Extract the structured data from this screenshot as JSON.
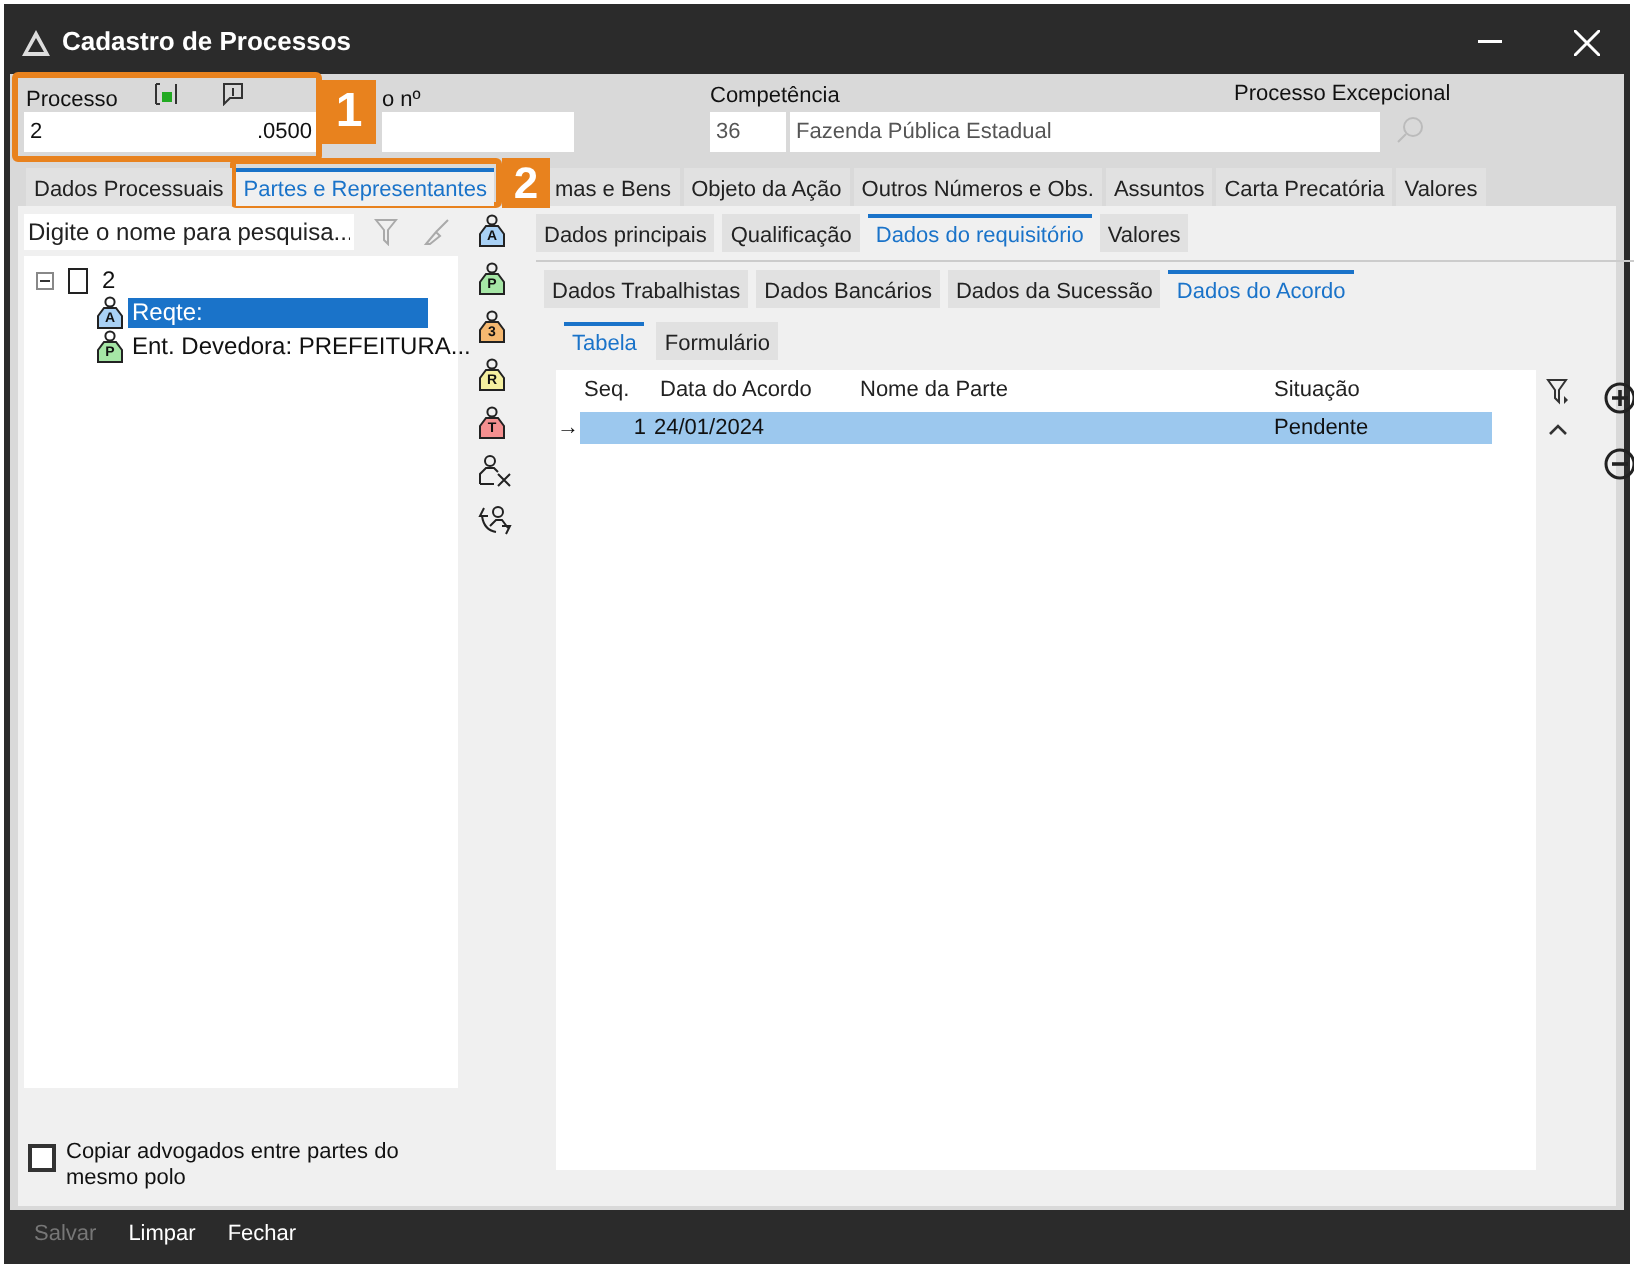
{
  "window": {
    "title": "Cadastro de Processos"
  },
  "header": {
    "process_label": "Processo",
    "process_value_start": "2",
    "process_value_end": ".0500",
    "second_label": "o nº",
    "competencia_label": "Competência",
    "competencia_code": "36",
    "competencia_name": "Fazenda Pública Estadual",
    "excepcional_label": "Processo Excepcional"
  },
  "tabs": [
    {
      "label": "Dados Processuais",
      "selected": false
    },
    {
      "label": "Partes e Representantes",
      "selected": true
    },
    {
      "label": "mas e Bens",
      "selected": false
    },
    {
      "label": "Objeto da Ação",
      "selected": false
    },
    {
      "label": "Outros Números e Obs.",
      "selected": false
    },
    {
      "label": "Assuntos",
      "selected": false
    },
    {
      "label": "Carta Precatória",
      "selected": false
    },
    {
      "label": "Valores",
      "selected": false
    }
  ],
  "search": {
    "placeholder": "Digite o nome para pesquisa..."
  },
  "tree": [
    {
      "label": "2",
      "expanded": true,
      "children": [
        {
          "label": "Reqte:",
          "letter": "A",
          "color": "#a9d1f5",
          "selected": true
        },
        {
          "label": "Ent. Devedora: PREFEITURA...",
          "letter": "P",
          "color": "#a6e6a6",
          "selected": false
        }
      ]
    }
  ],
  "party_tools": [
    {
      "kind": "party",
      "letter": "A",
      "color": "#a9d1f5"
    },
    {
      "kind": "party",
      "letter": "P",
      "color": "#a6e6a6"
    },
    {
      "kind": "party",
      "letter": "3",
      "color": "#f5b870"
    },
    {
      "kind": "party",
      "letter": "R",
      "color": "#f5f0a0"
    },
    {
      "kind": "party",
      "letter": "T",
      "color": "#f59090"
    },
    {
      "kind": "remove"
    },
    {
      "kind": "swap"
    }
  ],
  "subtabs": [
    {
      "label": "Dados principais",
      "selected": false
    },
    {
      "label": "Qualificação",
      "selected": false
    },
    {
      "label": "Dados do requisitório",
      "selected": true
    },
    {
      "label": "Valores",
      "selected": false
    }
  ],
  "subtabs2": [
    {
      "label": "Dados Trabalhistas",
      "selected": false
    },
    {
      "label": "Dados Bancários",
      "selected": false
    },
    {
      "label": "Dados da Sucessão",
      "selected": false
    },
    {
      "label": "Dados do Acordo",
      "selected": true
    }
  ],
  "view_tabs": [
    {
      "label": "Tabela",
      "selected": true
    },
    {
      "label": "Formulário",
      "selected": false
    }
  ],
  "grid": {
    "columns": [
      "Seq.",
      "Data do Acordo",
      "Nome da Parte",
      "Situação"
    ],
    "rows": [
      {
        "marker": "→",
        "seq": "1",
        "date": "24/01/2024",
        "situacao": "Pendente",
        "selected": true
      }
    ]
  },
  "copy_checkbox": {
    "label": "Copiar advogados entre partes do mesmo polo",
    "checked": false
  },
  "footer_buttons": [
    {
      "label": "Salvar",
      "disabled": true
    },
    {
      "label": "Limpar",
      "disabled": false
    },
    {
      "label": "Fechar",
      "disabled": false
    }
  ],
  "callouts": [
    {
      "number": "1"
    },
    {
      "number": "2"
    }
  ]
}
